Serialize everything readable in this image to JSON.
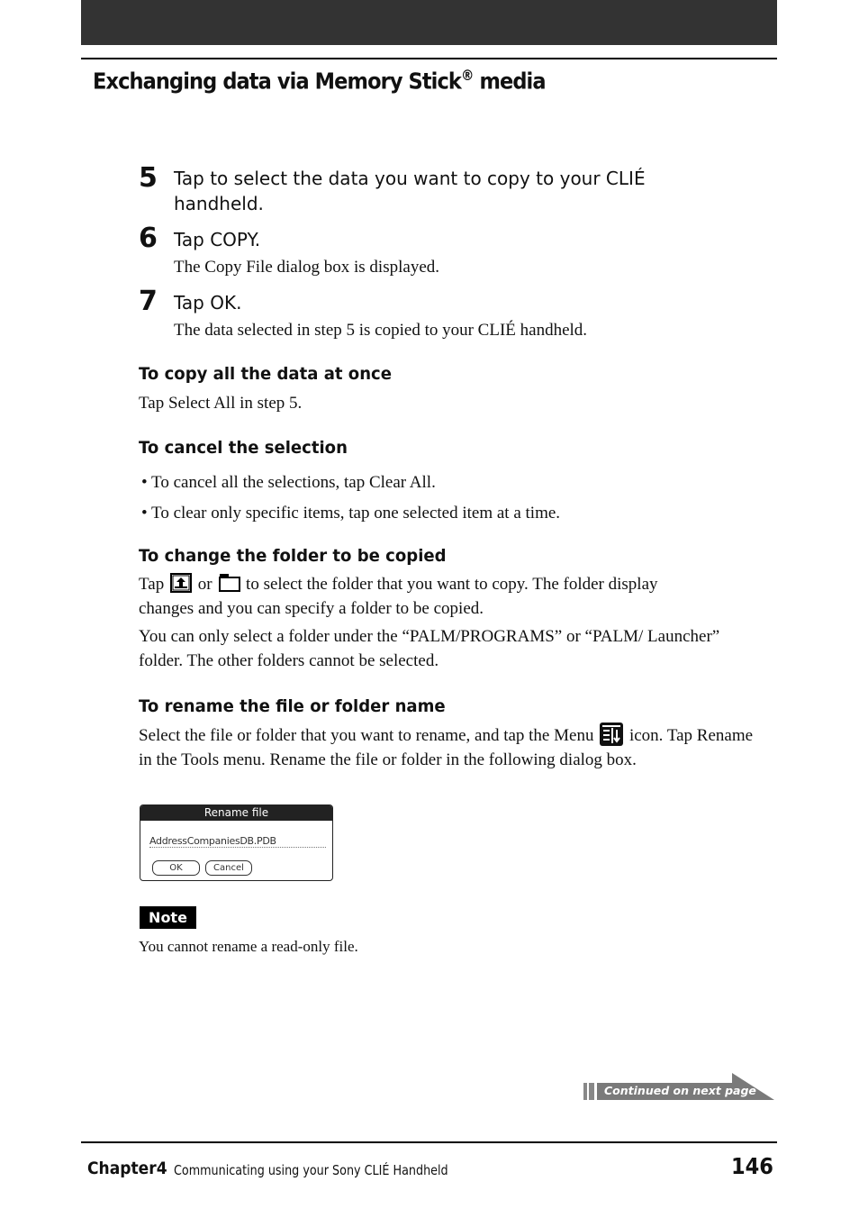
{
  "header": {
    "section_title": "Exchanging data via Memory Stick",
    "section_title_mark": "®",
    "section_title_suffix": " media"
  },
  "steps": [
    {
      "number": "5",
      "text_line1": "Tap to select the data you want to copy to your CLIÉ",
      "text_line2": "handheld.",
      "sub": ""
    },
    {
      "number": "6",
      "text_line1": "Tap COPY.",
      "sub": "The Copy File dialog box is displayed."
    },
    {
      "number": "7",
      "text_line1": "Tap OK.",
      "sub": "The data selected in step 5 is copied to your CLIÉ handheld."
    }
  ],
  "sections": {
    "copy_all": {
      "heading": "To copy all the data at once",
      "body": "Tap Select All in step 5."
    },
    "cancel": {
      "heading": "To cancel the selection",
      "bullets": [
        "• To cancel all the selections, tap Clear All.",
        "• To clear only specific items, tap one selected item at a time."
      ]
    },
    "change_folder": {
      "heading": "To change the folder to be copied",
      "p1_a": "Tap",
      "p1_b": "or",
      "p1_c": "to select the folder that you want to copy. The folder display",
      "p1_d": "changes and you can specify a folder to be copied.",
      "p2": "You can only select a folder under the “PALM/PROGRAMS” or “PALM/ Launcher” folder. The other folders cannot be selected."
    },
    "rename": {
      "heading": "To rename the file or folder name",
      "p_a": "Select the file or folder that you want to rename, and tap the Menu",
      "p_b": "icon. Tap Rename in the Tools menu. Rename the file or folder in the following dialog box."
    }
  },
  "dialog": {
    "title": "Rename file",
    "field_value": "AddressCompaniesDB.PDB",
    "ok_label": "OK",
    "cancel_label": "Cancel"
  },
  "note": {
    "badge": "Note",
    "text": "You cannot rename a read-only file."
  },
  "continued": {
    "label": "Continued on next page"
  },
  "footer": {
    "chapter": "Chapter4",
    "description": "Communicating using your Sony CLIÉ Handheld",
    "page_number": "146"
  }
}
